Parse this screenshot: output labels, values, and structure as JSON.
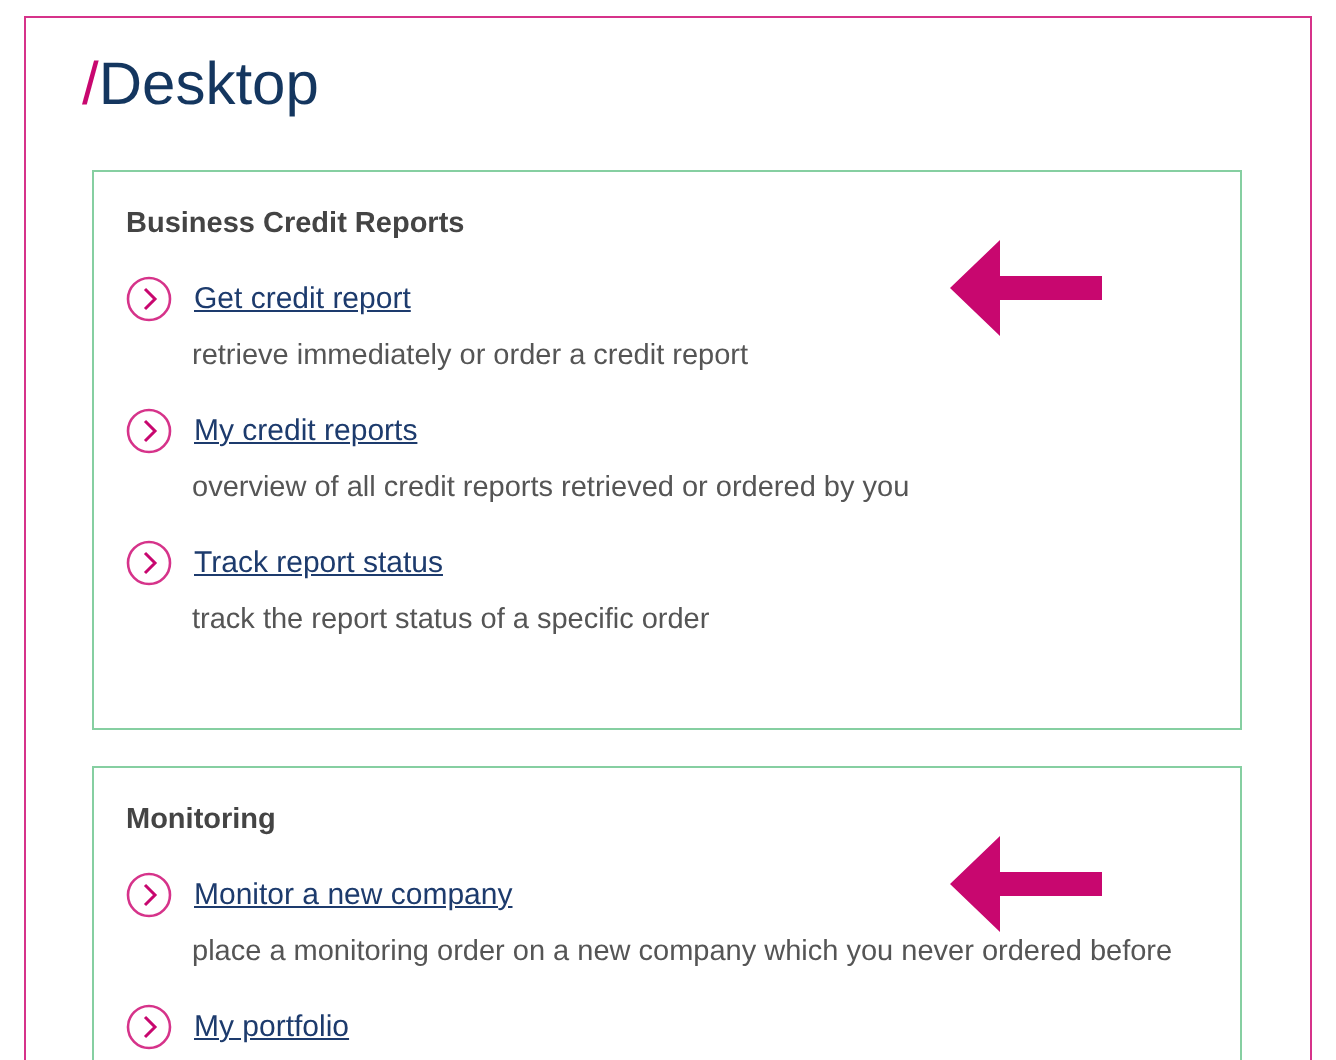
{
  "page_title": {
    "prefix": "/",
    "text": "Desktop"
  },
  "panels": [
    {
      "heading": "Business Credit Reports",
      "pointer_arrow": true,
      "items": [
        {
          "link": "Get credit report",
          "description": "retrieve immediately or order a credit report"
        },
        {
          "link": "My credit reports",
          "description": "overview of all credit reports retrieved or ordered by you"
        },
        {
          "link": "Track report status",
          "description": "track the report status of a specific order"
        }
      ]
    },
    {
      "heading": "Monitoring",
      "pointer_arrow": true,
      "items": [
        {
          "link": "Monitor a new company",
          "description": "place a monitoring order on a new company which you never ordered before"
        },
        {
          "link": "My portfolio"
        }
      ]
    }
  ]
}
